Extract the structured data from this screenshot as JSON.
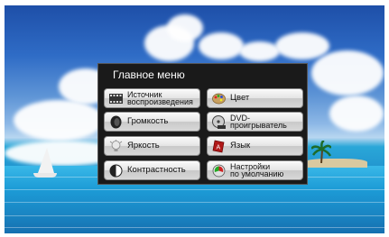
{
  "menu": {
    "title": "Главное меню",
    "items": [
      {
        "label": "Источник\nвоспроизведения",
        "icon": "film-strip-icon"
      },
      {
        "label": "Цвет",
        "icon": "palette-icon"
      },
      {
        "label": "Громкость",
        "icon": "speaker-icon"
      },
      {
        "label": "DVD-\nпроигрыватель",
        "icon": "dvd-player-icon"
      },
      {
        "label": "Яркость",
        "icon": "light-bulb-icon"
      },
      {
        "label": "Язык",
        "icon": "dictionary-icon"
      },
      {
        "label": "Контрастность",
        "icon": "contrast-icon"
      },
      {
        "label": "Настройки\nпо умолчанию",
        "icon": "reset-icon"
      }
    ]
  }
}
